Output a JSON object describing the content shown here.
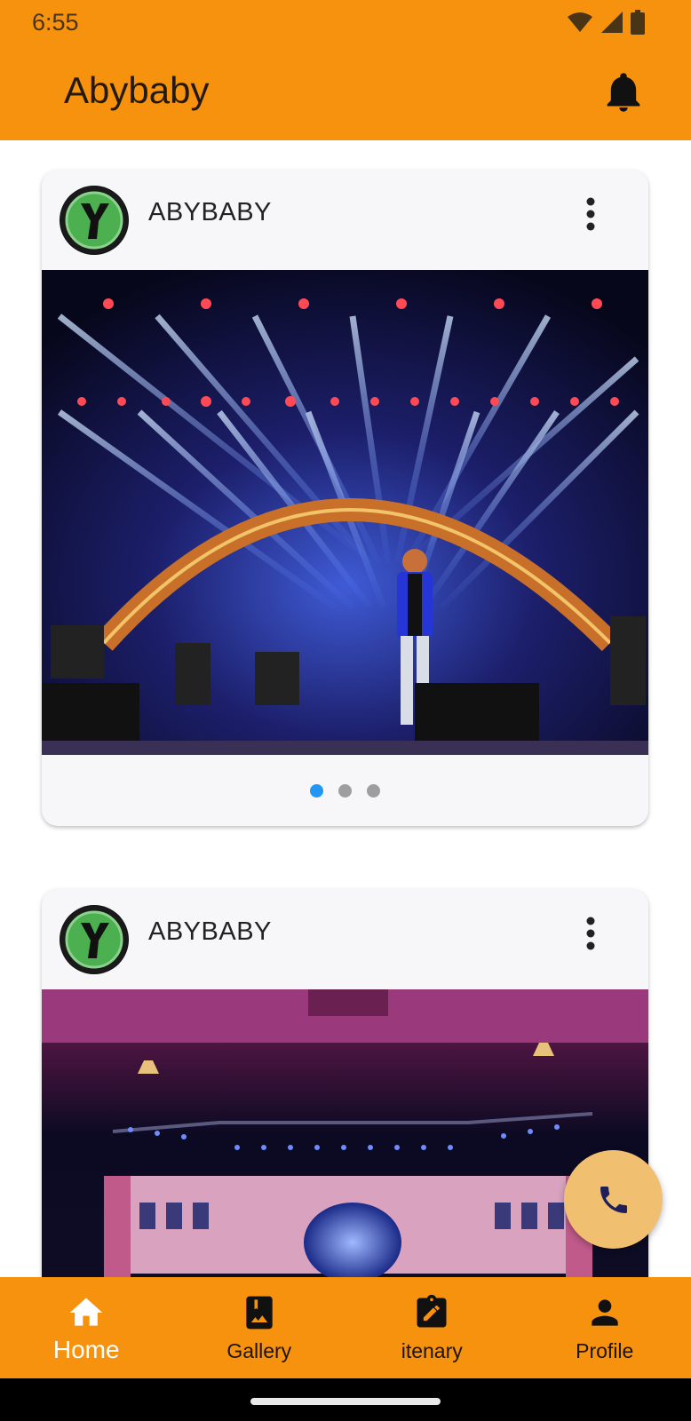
{
  "status_bar": {
    "time": "6:55",
    "icons": [
      "wifi-icon",
      "signal-icon",
      "battery-icon"
    ]
  },
  "app_bar": {
    "title": "Abybaby",
    "notification_icon": "bell-icon"
  },
  "colors": {
    "primary": "#f7920e",
    "card_bg": "#f7f7f9",
    "dot_active": "#2196f3",
    "dot_inactive": "#9e9e9e",
    "fab": "#f0c070",
    "fab_icon": "#1f1f5a"
  },
  "feed": {
    "posts": [
      {
        "author": "ABYBABY",
        "avatar_icon": "y-logo-avatar",
        "menu_icon": "more-vert-icon",
        "image": "concert-stage-singer-photo",
        "carousel": {
          "count": 3,
          "active_index": 0
        }
      },
      {
        "author": "ABYBABY",
        "avatar_icon": "y-logo-avatar",
        "menu_icon": "more-vert-icon",
        "image": "stage-arches-photo"
      }
    ]
  },
  "fab": {
    "icon": "phone-icon"
  },
  "bottom_nav": {
    "items": [
      {
        "label": "Home",
        "icon": "home-icon",
        "active": true
      },
      {
        "label": "Gallery",
        "icon": "gallery-icon",
        "active": false
      },
      {
        "label": "itenary",
        "icon": "assignment-icon",
        "active": false
      },
      {
        "label": "Profile",
        "icon": "person-icon",
        "active": false
      }
    ]
  }
}
